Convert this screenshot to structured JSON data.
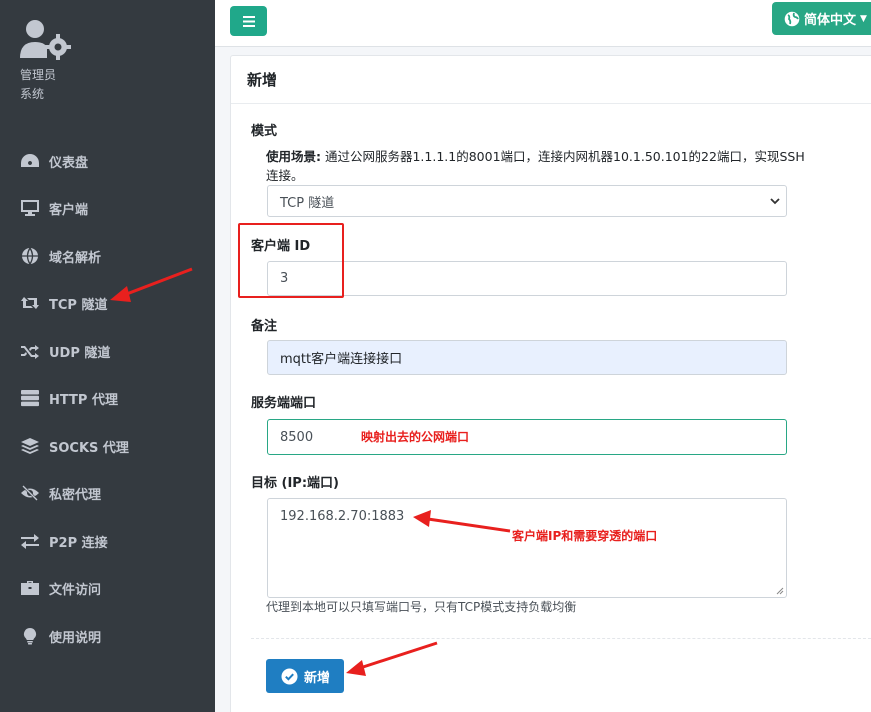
{
  "sidebar": {
    "user_line1": "管理员",
    "user_line2": "系统",
    "items": [
      {
        "label": "仪表盘",
        "icon": "dashboard-icon"
      },
      {
        "label": "客户端",
        "icon": "desktop-icon"
      },
      {
        "label": "域名解析",
        "icon": "globe-icon"
      },
      {
        "label": "TCP 隧道",
        "icon": "retweet-icon"
      },
      {
        "label": "UDP 隧道",
        "icon": "random-icon"
      },
      {
        "label": "HTTP 代理",
        "icon": "server-icon"
      },
      {
        "label": "SOCKS 代理",
        "icon": "layers-icon"
      },
      {
        "label": "私密代理",
        "icon": "eye-slash-icon"
      },
      {
        "label": "P2P 连接",
        "icon": "exchange-icon"
      },
      {
        "label": "文件访问",
        "icon": "briefcase-icon"
      },
      {
        "label": "使用说明",
        "icon": "lightbulb-icon"
      }
    ]
  },
  "topbar": {
    "language_label": "简体中文",
    "colors": {
      "menu_button": "#20a88a",
      "language_button": "#28a785"
    }
  },
  "card": {
    "title": "新增",
    "mode_label": "模式",
    "usage_title": "使用场景:",
    "usage_text": " 通过公网服务器1.1.1.1的8001端口，连接内网机器10.1.50.101的22端口，实现SSH连接。",
    "mode_value": "TCP 隧道",
    "client_id_label": "客户端 ID",
    "client_id_value": "3",
    "remark_label": "备注",
    "remark_value": "mqtt客户端连接接口",
    "server_port_label": "服务端端口",
    "server_port_value": "8500",
    "target_label": "目标 (IP:端口)",
    "target_value": "192.168.2.70:1883",
    "target_note": "代理到本地可以只填写端口号，只有TCP模式支持负载均衡",
    "submit_label": "新增"
  },
  "annotations": {
    "port_note": "映射出去的公网端口",
    "target_note": "客户端IP和需要穿透的端口",
    "color": "#e8201e"
  }
}
